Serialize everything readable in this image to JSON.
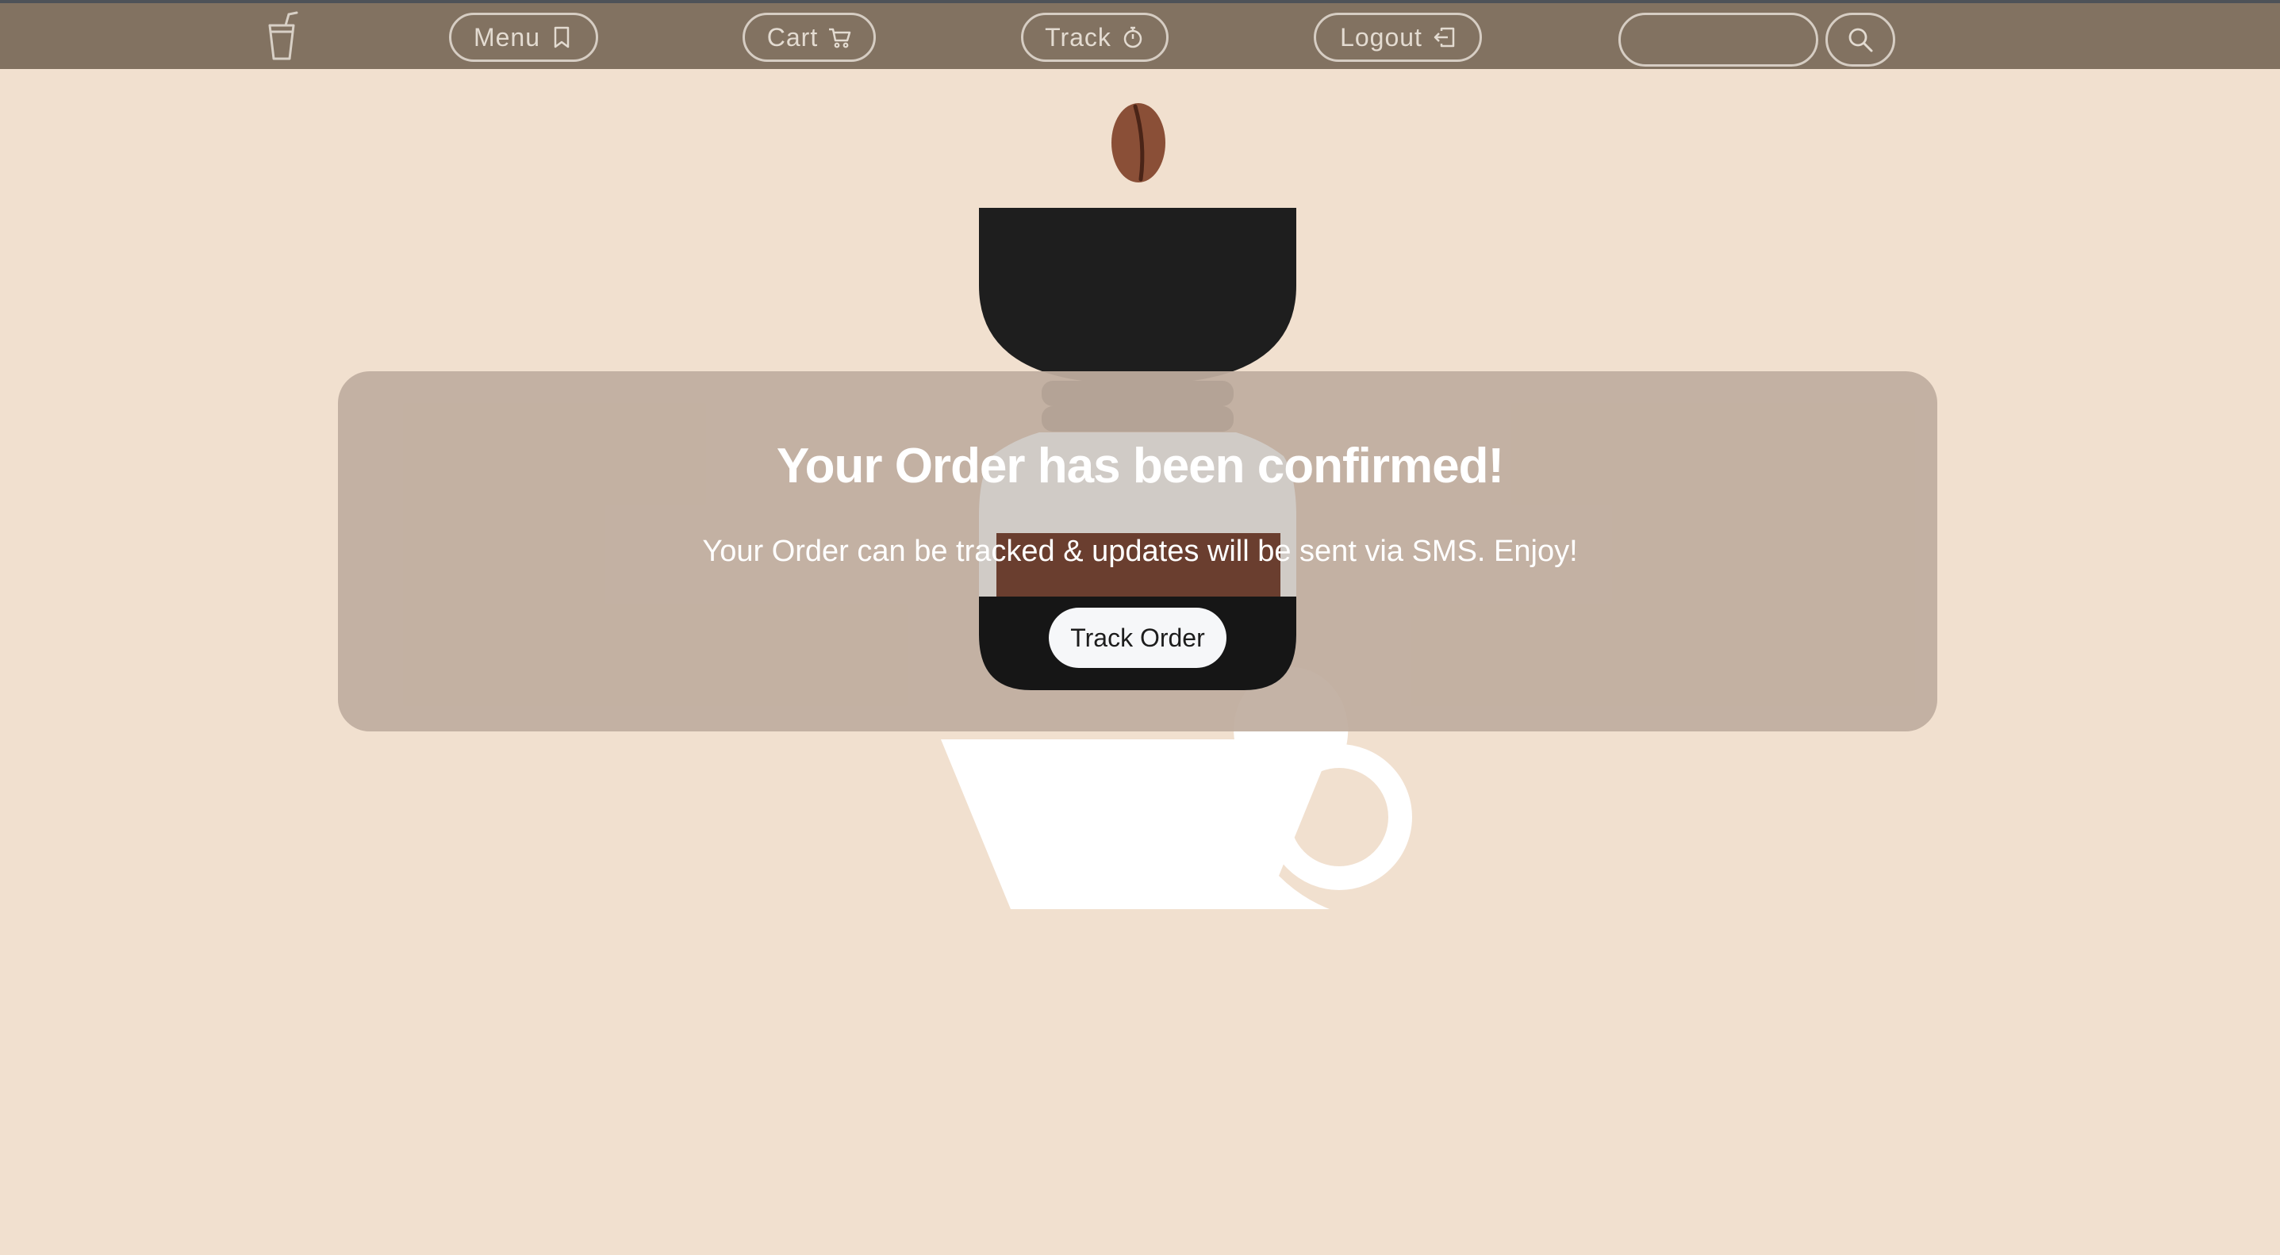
{
  "nav": {
    "menu_label": "Menu",
    "cart_label": "Cart",
    "track_label": "Track",
    "logout_label": "Logout",
    "search_placeholder": "",
    "icons": {
      "logo": "cup-with-straw-icon",
      "menu": "bookmark-icon",
      "cart": "cart-icon",
      "track": "stopwatch-icon",
      "logout": "logout-icon",
      "search": "search-icon"
    }
  },
  "confirmation": {
    "title": "Your Order has been confirmed!",
    "message": "Your Order can be tracked & updates will be sent via SMS. Enjoy!",
    "track_button_label": "Track Order"
  },
  "colors": {
    "background": "#f1e0cf",
    "navbar": "#827261",
    "panel": "#bfad9f",
    "grinder": "#1e1e1e",
    "coffee": "#6a3e2f",
    "bean": "#8a4f37"
  }
}
